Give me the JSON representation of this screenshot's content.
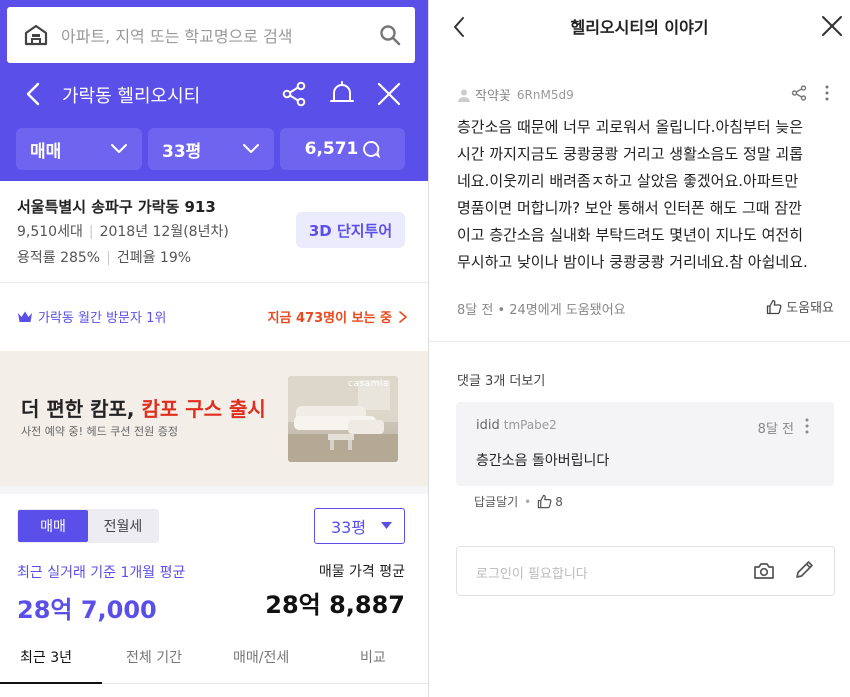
{
  "search": {
    "placeholder": "아파트, 지역 또는 학교명으로 검색"
  },
  "header": {
    "title": "가락동 헬리오시티"
  },
  "filters": {
    "type": "매매",
    "size": "33평",
    "count": "6,571"
  },
  "complex": {
    "address": "서울특별시 송파구 가락동 913",
    "households": "9,510세대",
    "built": "2018년 12월(8년차)",
    "far": "용적률 285%",
    "bcr": "건폐율 19%",
    "tour_button": "3D 단지투어"
  },
  "visitors": {
    "rank": "가락동 월간 방문자 1위",
    "now": "지금 473명이 보는 중"
  },
  "ad": {
    "title_main": "더 편한 캄포, ",
    "title_accent": "캄포 구스 출시",
    "subtitle": "사전 예약 중! 헤드 쿠션 전원 증정",
    "brand": "casamia"
  },
  "price": {
    "seg_sale": "매매",
    "seg_rent": "전월세",
    "size_select": "33평",
    "recent_label": "최근 실거래 기준 1개월 평균",
    "recent_value": "28억 7,000",
    "avg_label": "매물 가격 평균",
    "avg_value": "28억 8,887"
  },
  "tabs": [
    "최근 3년",
    "전체 기간",
    "매매/전세",
    "비교"
  ],
  "story": {
    "title": "헬리오시티의 이야기",
    "author": "작약꽃",
    "author_id": "6RnM5d9",
    "body": "층간소음 때문에 너무 괴로워서 올립니다.아침부터 늦은\n시간 까지지금도 쿵쾅쿵쾅 거리고 생활소음도 정말 괴롭\n네요.이웃끼리 배려좀ㅈ하고 살았음 좋겠어요.아파트만\n명품이면 머합니까? 보안  통해서 인터폰 해도 그때 잠깐\n이고 층간소음 실내화 부탁드려도 몇년이 지나도 여전히\n무시하고 낮이나 밤이나 쿵쾅쿵쾅 거리네요.참 아쉽네요.",
    "meta": "8달 전 • 24명에게 도움됐어요",
    "helpful_label": "도움돼요",
    "more_comments": "댓글 3개 더보기"
  },
  "comment": {
    "user": "idid",
    "user_id": "tmPabe2",
    "time": "8달 전",
    "text": "층간소음 돌아버립니다",
    "reply_label": "답글달기",
    "like_count": "8"
  },
  "login": {
    "placeholder": "로그인이 필요합니다"
  },
  "colors": {
    "brand": "#5b4fe9",
    "alert": "#e8491d",
    "ad_accent": "#e02d1e"
  }
}
